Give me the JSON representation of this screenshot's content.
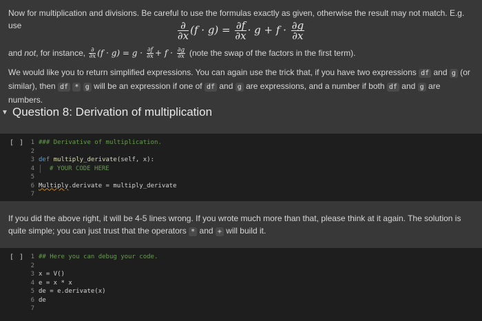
{
  "intro": {
    "line1": "Now for multiplication and divisions. Be careful to use the formulas exactly as given, otherwise the result may not match. E.g. use",
    "formula": {
      "d": "∂",
      "dx": "∂x",
      "lhs_rest": "(f · g) =",
      "df": "∂f",
      "times_g_plus_f": "· g + f ·",
      "dg": "∂g"
    },
    "not_line": {
      "prefix": "and",
      "not": "not",
      "after_not": ", for instance,",
      "math_mid": "(f · g) = g ·",
      "math_plus": "+ f ·",
      "suffix": "(note the swap of the factors in the first term)."
    },
    "para2": {
      "t1": "We would like you to return simplified expressions. You can again use the trick that, if you have two expressions",
      "c1": "df",
      "t2": "and",
      "c2": "g",
      "t3": "(or similar), then",
      "c3": "df",
      "c4": "*",
      "c5": "g",
      "t4": "will be an expression if one of",
      "c6": "df",
      "t5": "and",
      "c7": "g",
      "t6": "are expressions, and a number if both",
      "c8": "df",
      "t7": "and",
      "c9": "g",
      "t8": "are numbers."
    }
  },
  "section": {
    "title": "Question 8: Derivation of multiplication",
    "chevron_icon": "chevron-down-icon"
  },
  "cell1": {
    "run_label": "[ ]",
    "lines": [
      {
        "n": "1",
        "text": "### Derivative of multiplication."
      },
      {
        "n": "2",
        "text": ""
      },
      {
        "n": "3",
        "kw": "def",
        "fn": "multiply_derivate",
        "rest": "(self, x):"
      },
      {
        "n": "4",
        "text": "# YOUR CODE HERE"
      },
      {
        "n": "5",
        "text": ""
      },
      {
        "n": "6",
        "cls": "Multiply",
        "rest": ".derivate = multiply_derivate"
      },
      {
        "n": "7",
        "text": ""
      }
    ]
  },
  "middle_text": {
    "t1": "If you did the above right, it will be 4-5 lines wrong. If you wrote much more than that, please think at it again. The solution is quite simple; you can just trust that the operators",
    "c1": "*",
    "t2": "and",
    "c2": "+",
    "t3": "will build it."
  },
  "cell2": {
    "run_label": "[ ]",
    "lines": [
      {
        "n": "1",
        "text": "## Here you can debug your code."
      },
      {
        "n": "2",
        "text": ""
      },
      {
        "n": "3",
        "text": "x = V()"
      },
      {
        "n": "4",
        "text": "e = x * x"
      },
      {
        "n": "5",
        "text": "de = e.derivate(x)"
      },
      {
        "n": "6",
        "text": "de"
      },
      {
        "n": "7",
        "text": ""
      }
    ]
  }
}
